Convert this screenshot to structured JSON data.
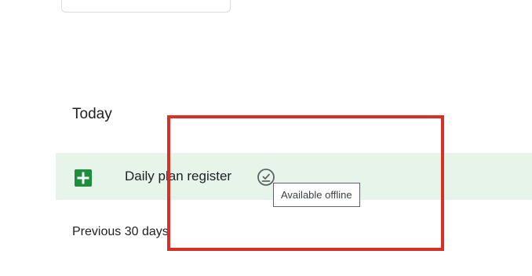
{
  "sections": {
    "today_label": "Today",
    "previous_label": "Previous 30 days"
  },
  "file_row": {
    "name": "Daily plan register",
    "icon": "google-sheets-icon",
    "status_icon": "available-offline-icon",
    "row_color": "#e6f4ea",
    "icon_color": "#1e8e3e"
  },
  "tooltip": {
    "text": "Available offline"
  },
  "annotation": {
    "highlight_color": "#d93025"
  }
}
